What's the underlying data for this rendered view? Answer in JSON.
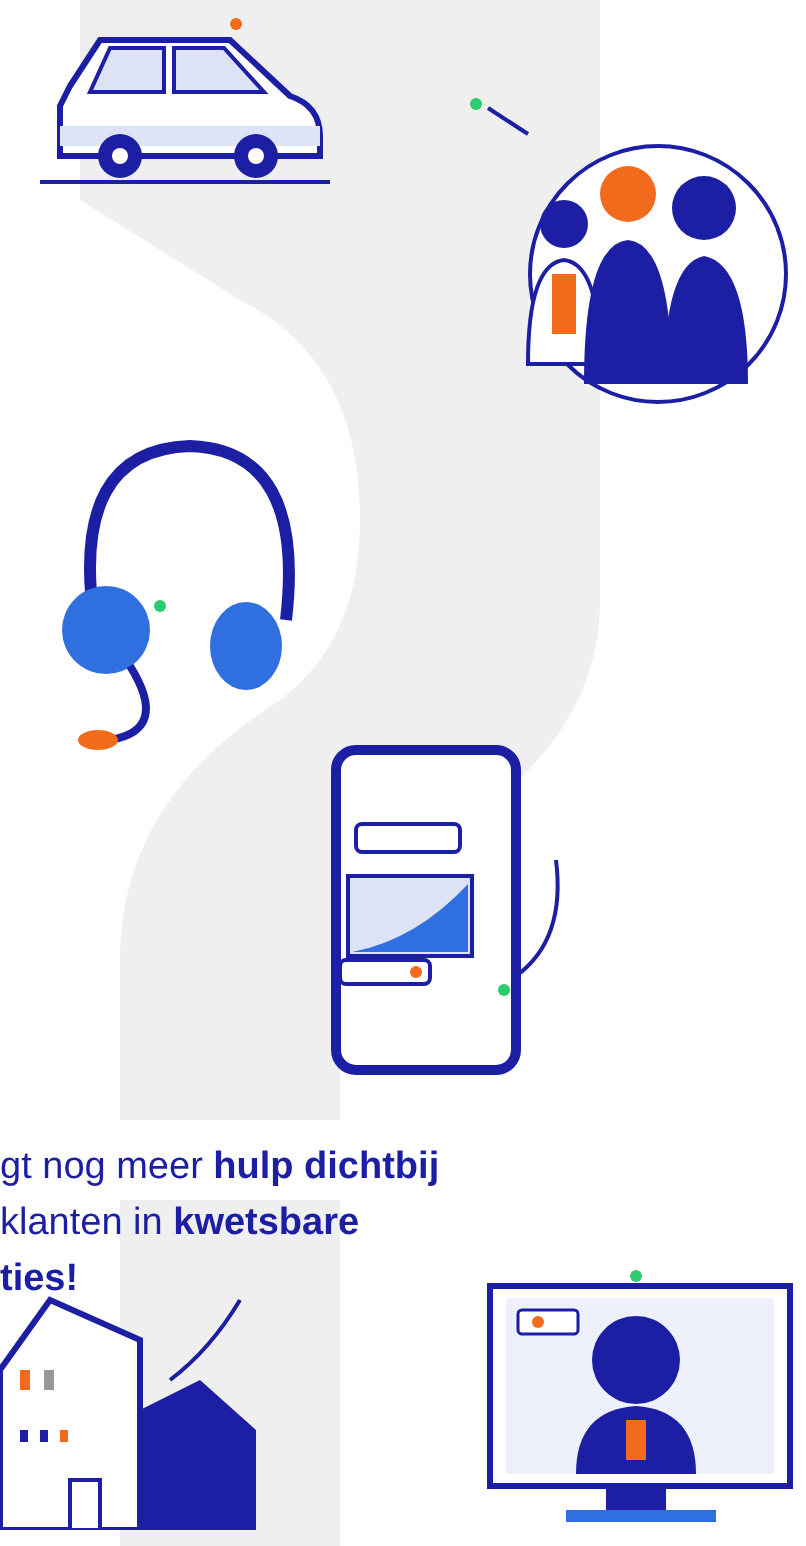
{
  "tagline": {
    "lines": [
      "gt nog meer **hulp dichtbij**",
      "klanten in **kwetsbare**",
      "**ties!**"
    ]
  }
}
